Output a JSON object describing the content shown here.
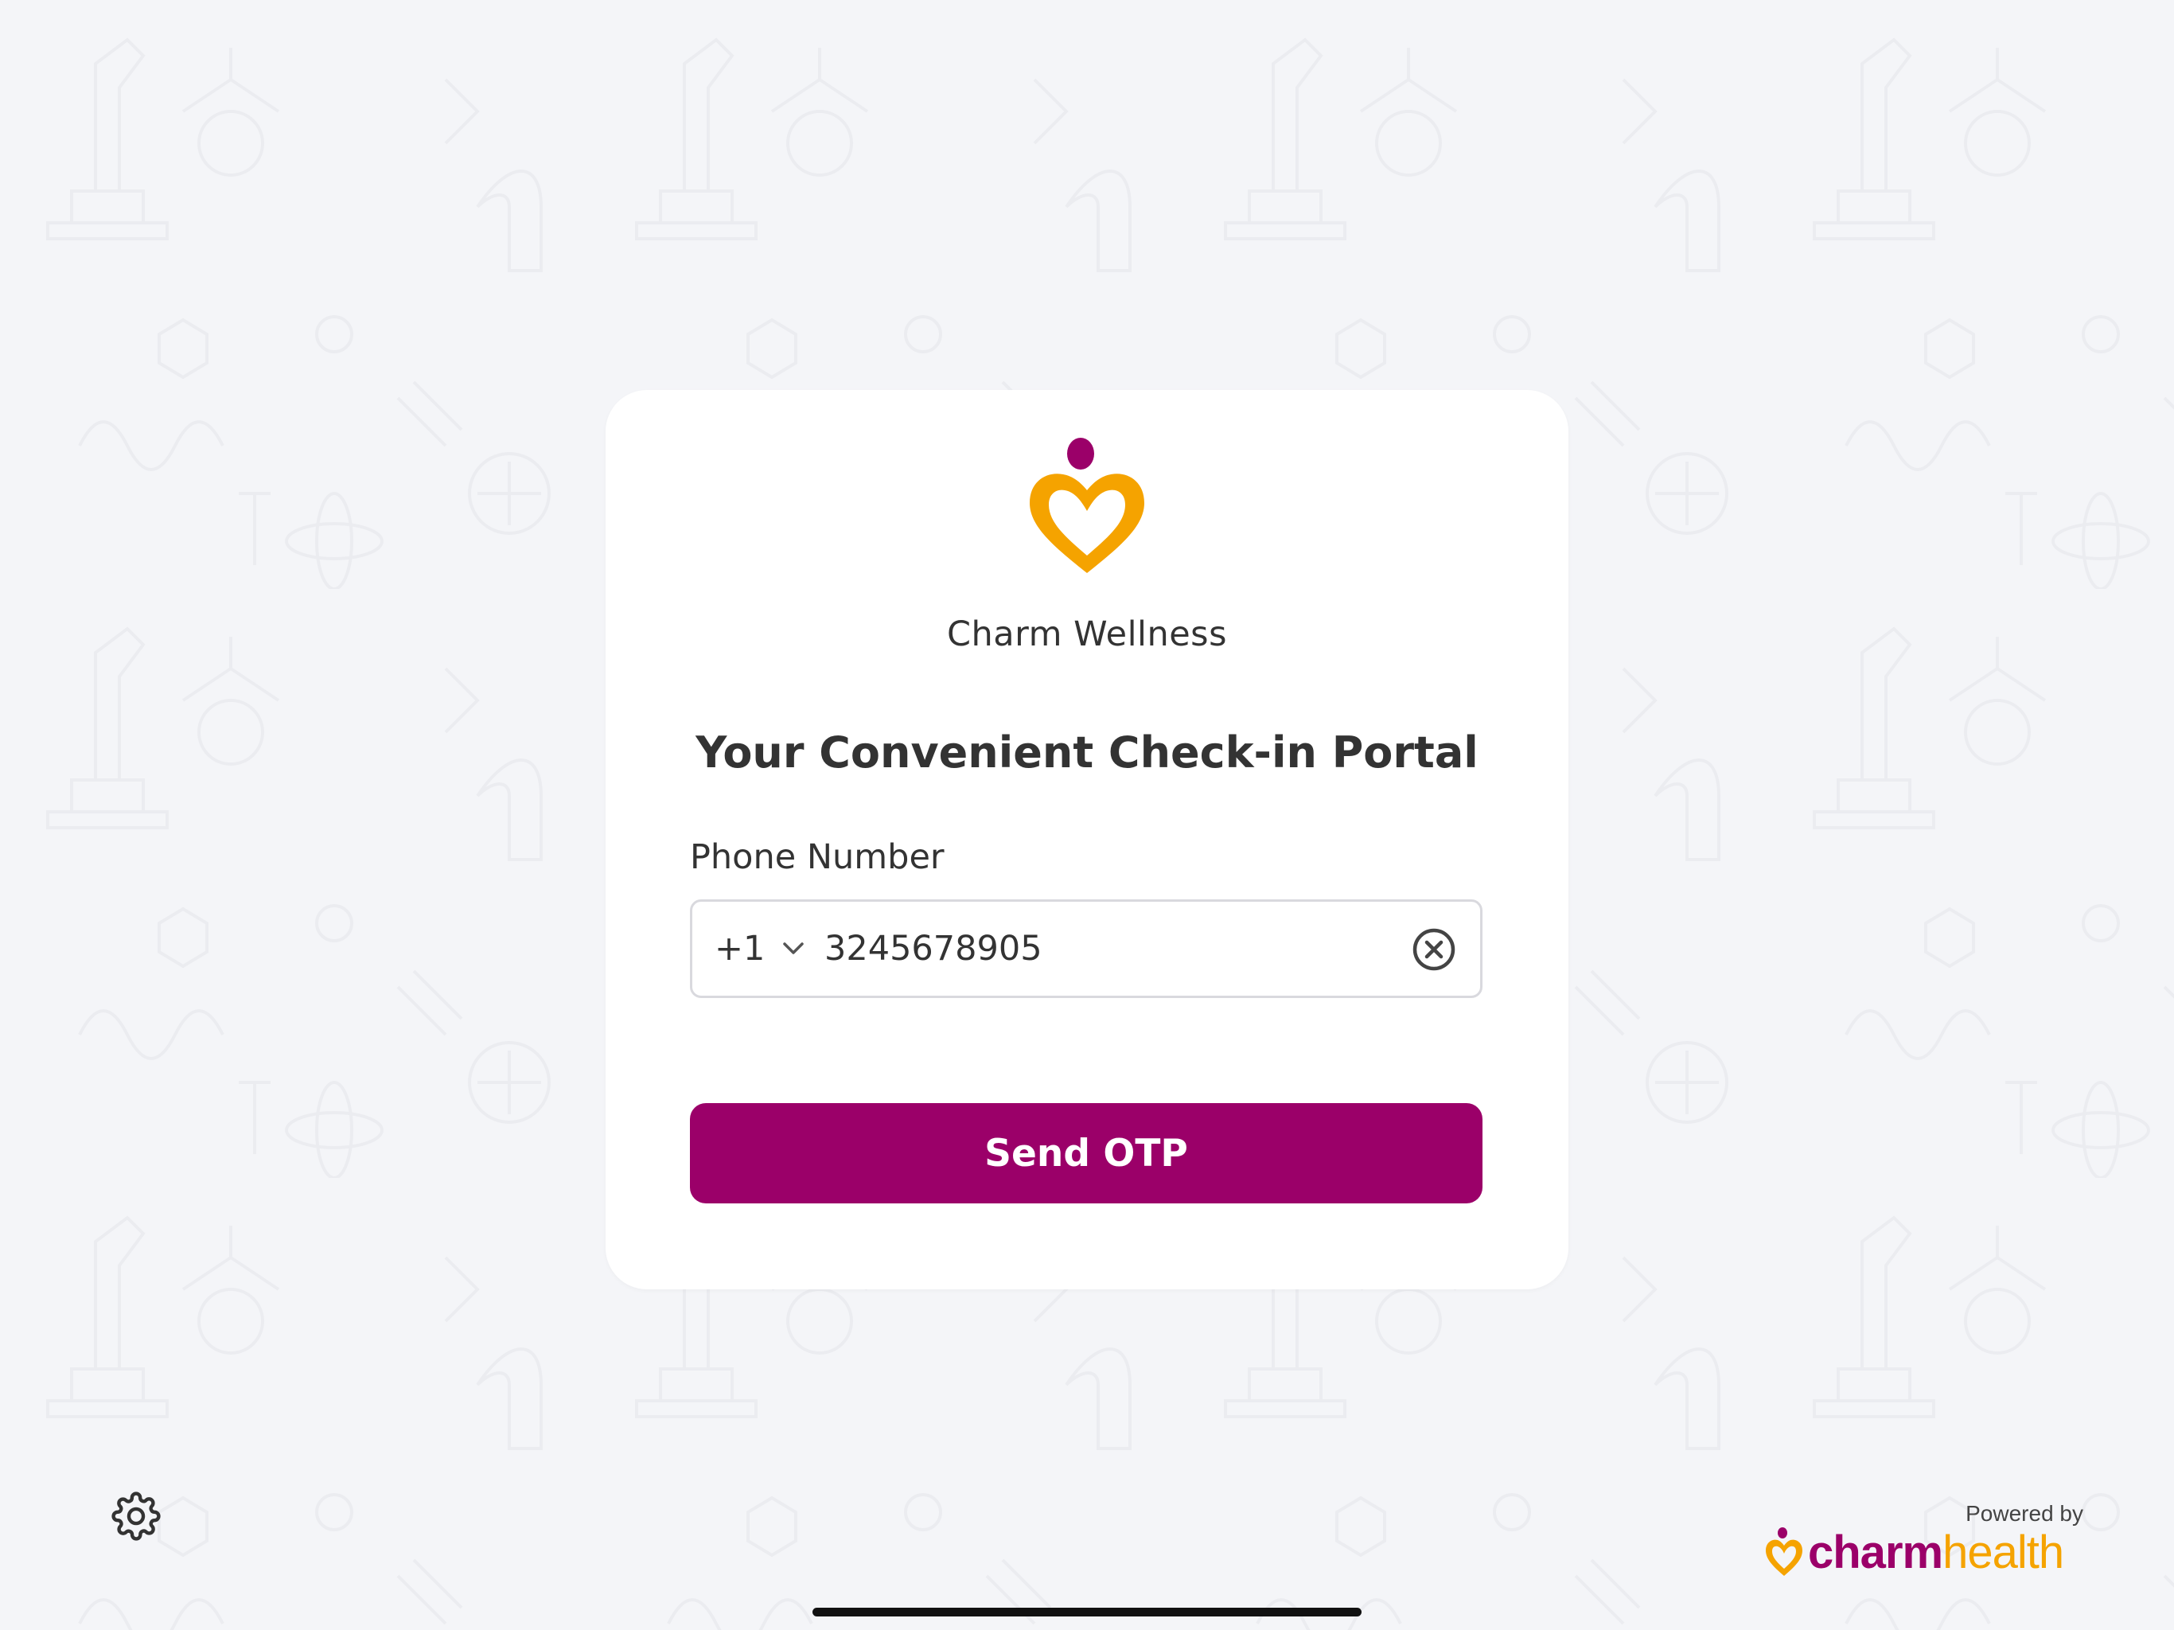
{
  "app": {
    "clinic_name": "Charm Wellness",
    "headline": "Your Convenient Check-in Portal"
  },
  "form": {
    "phone_label": "Phone Number",
    "country_code": "+1",
    "phone_value": "3245678905",
    "send_button_label": "Send OTP"
  },
  "footer": {
    "powered_by": "Powered by",
    "brand_part1": "charm",
    "brand_part2": "health"
  },
  "icons": {
    "logo": "charm-heart-logo-icon",
    "chevron": "chevron-down-icon",
    "clear": "clear-circle-x-icon",
    "settings": "gear-icon"
  },
  "colors": {
    "primary": "#9b0069",
    "accent": "#f5a300",
    "background": "#f4f5f8",
    "card": "#ffffff",
    "text": "#333333"
  }
}
